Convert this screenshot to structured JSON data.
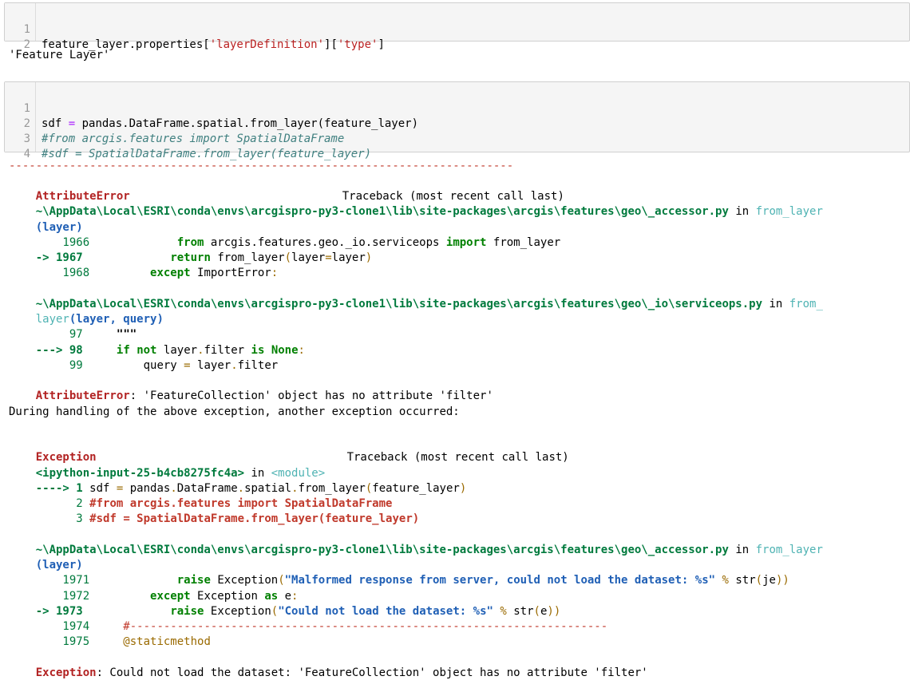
{
  "cell1": {
    "lines": [
      "feature_layer.properties['layerDefinition']['type']",
      ""
    ],
    "line_numbers": [
      "1",
      "2"
    ],
    "output": "'Feature Layer'"
  },
  "cell2": {
    "line_numbers": [
      "1",
      "2",
      "3",
      "4"
    ],
    "l1_a": "sdf ",
    "l1_eq": "=",
    "l1_b": " pandas.DataFrame.spatial.from_layer(feature_layer)",
    "l2": "#from arcgis.features import SpatialDataFrame",
    "l3": "#sdf = SpatialDataFrame.from_layer(feature_layer)"
  },
  "traceback": {
    "dashes": "---------------------------------------------------------------------------",
    "err1_name": "AttributeError",
    "tb_label": "Traceback (most recent call last)",
    "path1": "~\\AppData\\Local\\ESRI\\conda\\envs\\arcgispro-py3-clone1\\lib\\site-packages\\arcgis\\features\\geo\\_accessor.py",
    "in": " in ",
    "fn1": "from_layer",
    "args1": "(layer)",
    "f1_l1966_no": "    1966",
    "f1_l1966": "             from arcgis.features.geo._io.serviceops import from_layer",
    "f1_l1967_no": "-> 1967",
    "f1_l1967": "             return from_layer(layer=layer)",
    "f1_l1968_no": "    1968",
    "f1_l1968": "         except ImportError:",
    "path2": "~\\AppData\\Local\\ESRI\\conda\\envs\\arcgispro-py3-clone1\\lib\\site-packages\\arcgis\\features\\geo\\_io\\serviceops.py",
    "fn2_a": "from_",
    "fn2_b": "layer",
    "args2": "(layer, query)",
    "f2_l97_no": "     97",
    "f2_l97": "     \"\"\"",
    "f2_l98_no": "---> 98",
    "f2_l98": "     if not layer.filter is None:",
    "f2_l99_no": "     99",
    "f2_l99": "         query = layer.filter",
    "err1_msg": ": 'FeatureCollection' object has no attribute 'filter'",
    "during": "During handling of the above exception, another exception occurred:",
    "err2_name": "Exception",
    "ipy": "<ipython-input-25-b4cb8275fc4a>",
    "module": "<module>",
    "f3_l1": "----> 1 sdf = pandas.DataFrame.spatial.from_layer(feature_layer)",
    "f3_l2": "      2 #from arcgis.features import SpatialDataFrame",
    "f3_l3": "      3 #sdf = SpatialDataFrame.from_layer(feature_layer)",
    "path3": "~\\AppData\\Local\\ESRI\\conda\\envs\\arcgispro-py3-clone1\\lib\\site-packages\\arcgis\\features\\geo\\_accessor.py",
    "fn3": "from_layer",
    "args3": "(layer)",
    "f4_l1971_no": "    1971",
    "f4_l1971_pre": "             raise Exception(",
    "f4_l1971_str": "\"Malformed response from server, could not load the dataset: %s\"",
    "f4_l1971_post": " % str(je))",
    "f4_l1972_no": "    1972",
    "f4_l1972": "         except Exception as e:",
    "f4_l1973_no": "-> 1973",
    "f4_l1973_pre": "             raise Exception(",
    "f4_l1973_str": "\"Could not load the dataset: %s\"",
    "f4_l1973_post": " % str(e))",
    "f4_l1974_no": "    1974",
    "f4_l1974": "     #-----------------------------------------------------------------------",
    "f4_l1975_no": "    1975",
    "f4_l1975": "     @staticmethod",
    "err2_msg": ": Could not load the dataset: 'FeatureCollection' object has no attribute 'filter'"
  }
}
